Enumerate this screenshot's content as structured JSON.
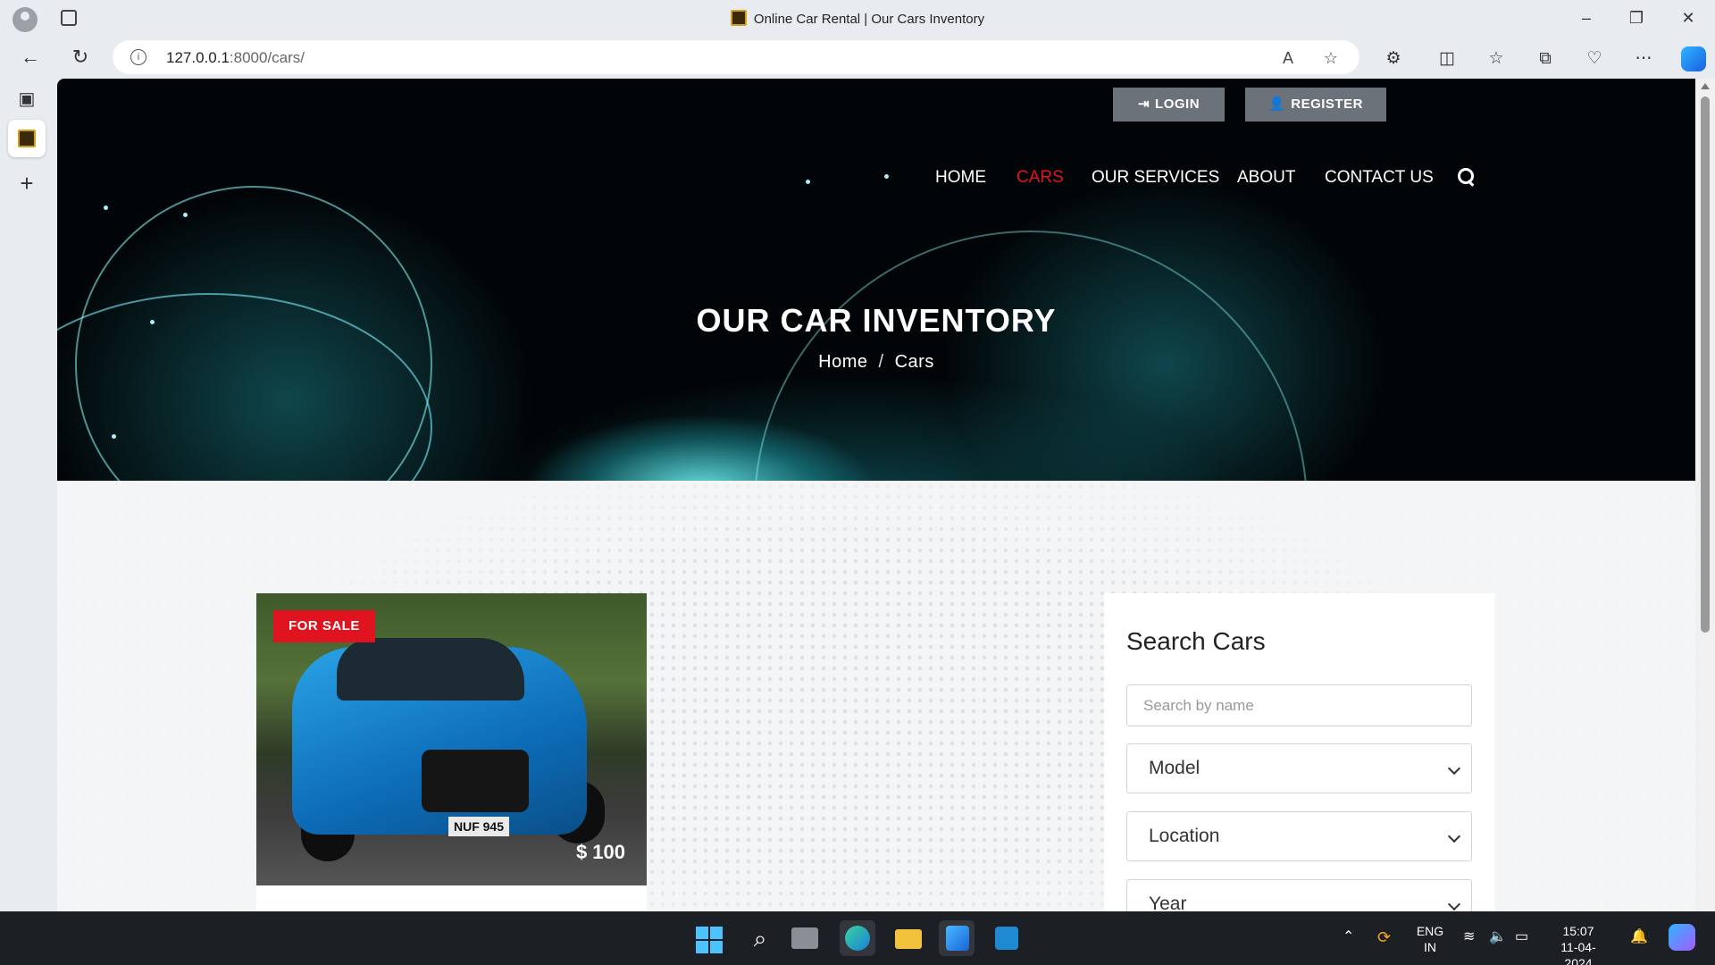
{
  "browser": {
    "window_title": "Online Car Rental | Our Cars Inventory",
    "url_host": "127.0.0.1",
    "url_rest": ":8000/cars/"
  },
  "site": {
    "top_buttons": {
      "login": "LOGIN",
      "register": "REGISTER"
    },
    "nav": [
      "HOME",
      "CARS",
      "OUR SERVICES",
      "ABOUT",
      "CONTACT US"
    ],
    "active_nav": "CARS",
    "hero_title": "OUR CAR INVENTORY",
    "breadcrumb": [
      "Home",
      "Cars"
    ],
    "accent_color": "#e0141e"
  },
  "car_card": {
    "badge": "FOR SALE",
    "price": "$ 100",
    "plate": "NUF 945"
  },
  "search_panel": {
    "title": "Search Cars",
    "name_placeholder": "Search by name",
    "model": "Model",
    "location": "Location",
    "year": "Year"
  },
  "taskbar": {
    "lang": "ENG",
    "region": "IN",
    "time": "15:07",
    "date": "11-04-2024"
  }
}
